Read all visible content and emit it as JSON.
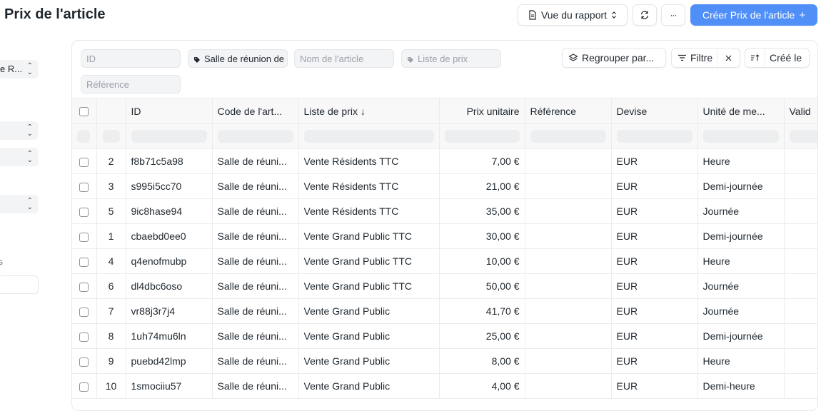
{
  "header": {
    "title": "Prix de l'article",
    "report_view_label": "Vue du rapport",
    "more_label": "···",
    "create_label": "Créer Prix de l'article",
    "create_plus": "+"
  },
  "sidebar": {
    "select1_value": "e R...",
    "side_char": "s"
  },
  "filters": {
    "id_placeholder": "ID",
    "room_filter": "Salle de réunion de",
    "item_name_placeholder": "Nom de l'article",
    "price_list_placeholder": "Liste de prix",
    "reference_placeholder": "Référence",
    "group_by_label": "Regrouper par...",
    "filter_label": "Filtre",
    "sort_label": "Créé le"
  },
  "table": {
    "columns": [
      "ID",
      "Code de l'art...",
      "Liste de prix ↓",
      "Prix unitaire",
      "Référence",
      "Devise",
      "Unité de me...",
      "Valid"
    ],
    "rows": [
      {
        "n": "2",
        "id": "f8b71c5a98",
        "code": "Salle de réuni...",
        "list": "Vente Résidents TTC",
        "price": "7,00 €",
        "ref": "",
        "currency": "EUR",
        "unit": "Heure"
      },
      {
        "n": "3",
        "id": "s995i5cc70",
        "code": "Salle de réuni...",
        "list": "Vente Résidents TTC",
        "price": "21,00 €",
        "ref": "",
        "currency": "EUR",
        "unit": "Demi-journée"
      },
      {
        "n": "5",
        "id": "9ic8hase94",
        "code": "Salle de réuni...",
        "list": "Vente Résidents TTC",
        "price": "35,00 €",
        "ref": "",
        "currency": "EUR",
        "unit": "Journée"
      },
      {
        "n": "1",
        "id": "cbaebd0ee0",
        "code": "Salle de réuni...",
        "list": "Vente Grand Public TTC",
        "price": "30,00 €",
        "ref": "",
        "currency": "EUR",
        "unit": "Demi-journée"
      },
      {
        "n": "4",
        "id": "q4enofmubp",
        "code": "Salle de réuni...",
        "list": "Vente Grand Public TTC",
        "price": "10,00 €",
        "ref": "",
        "currency": "EUR",
        "unit": "Heure"
      },
      {
        "n": "6",
        "id": "dl4dbc6oso",
        "code": "Salle de réuni...",
        "list": "Vente Grand Public TTC",
        "price": "50,00 €",
        "ref": "",
        "currency": "EUR",
        "unit": "Journée"
      },
      {
        "n": "7",
        "id": "vr88j3r7j4",
        "code": "Salle de réuni...",
        "list": "Vente Grand Public",
        "price": "41,70 €",
        "ref": "",
        "currency": "EUR",
        "unit": "Journée"
      },
      {
        "n": "8",
        "id": "1uh74mu6ln",
        "code": "Salle de réuni...",
        "list": "Vente Grand Public",
        "price": "25,00 €",
        "ref": "",
        "currency": "EUR",
        "unit": "Demi-journée"
      },
      {
        "n": "9",
        "id": "puebd42lmp",
        "code": "Salle de réuni...",
        "list": "Vente Grand Public",
        "price": "8,00 €",
        "ref": "",
        "currency": "EUR",
        "unit": "Heure"
      },
      {
        "n": "10",
        "id": "1smociiu57",
        "code": "Salle de réuni...",
        "list": "Vente Grand Public",
        "price": "4,00 €",
        "ref": "",
        "currency": "EUR",
        "unit": "Demi-heure"
      }
    ]
  },
  "colors": {
    "primary": "#4f8ff7",
    "text": "#1f272e",
    "muted": "#9aa1a9",
    "control_bg": "#f3f4f6",
    "border": "#e6e8eb"
  }
}
